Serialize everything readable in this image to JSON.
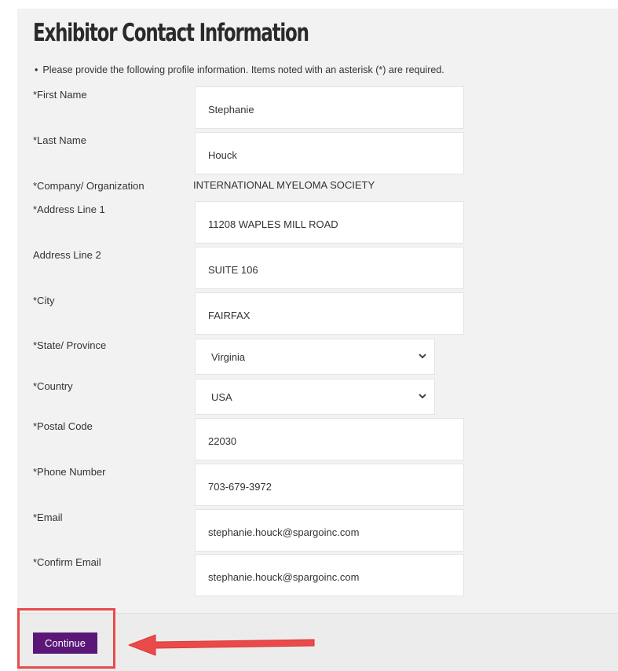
{
  "page": {
    "title": "Exhibitor Contact Information",
    "intro_bullet": "•",
    "intro": "Please provide the following profile information. Items noted with an asterisk (*) are required."
  },
  "form": {
    "first_name": {
      "label": "*First Name",
      "value": "Stephanie"
    },
    "last_name": {
      "label": "*Last Name",
      "value": "Houck"
    },
    "company": {
      "label": "*Company/ Organization",
      "value": "INTERNATIONAL MYELOMA SOCIETY"
    },
    "address1": {
      "label": "*Address Line 1",
      "value": "11208 WAPLES MILL ROAD"
    },
    "address2": {
      "label": "Address Line 2",
      "value": "SUITE 106"
    },
    "city": {
      "label": "*City",
      "value": "FAIRFAX"
    },
    "state": {
      "label": "*State/ Province",
      "value": "Virginia"
    },
    "country": {
      "label": "*Country",
      "value": "USA"
    },
    "postal": {
      "label": "*Postal Code",
      "value": "22030"
    },
    "phone": {
      "label": "*Phone Number",
      "value": "703-679-3972"
    },
    "email": {
      "label": "*Email",
      "value": "stephanie.houck@spargoinc.com"
    },
    "confirm_email": {
      "label": "*Confirm Email",
      "value": "stephanie.houck@spargoinc.com"
    }
  },
  "footer": {
    "continue_label": "Continue"
  },
  "colors": {
    "button": "#5a1778",
    "annotation": "#e94b4b"
  },
  "icons": {
    "select_chevron": "chevron-down-icon",
    "annotation_arrow": "arrow-left-icon"
  }
}
